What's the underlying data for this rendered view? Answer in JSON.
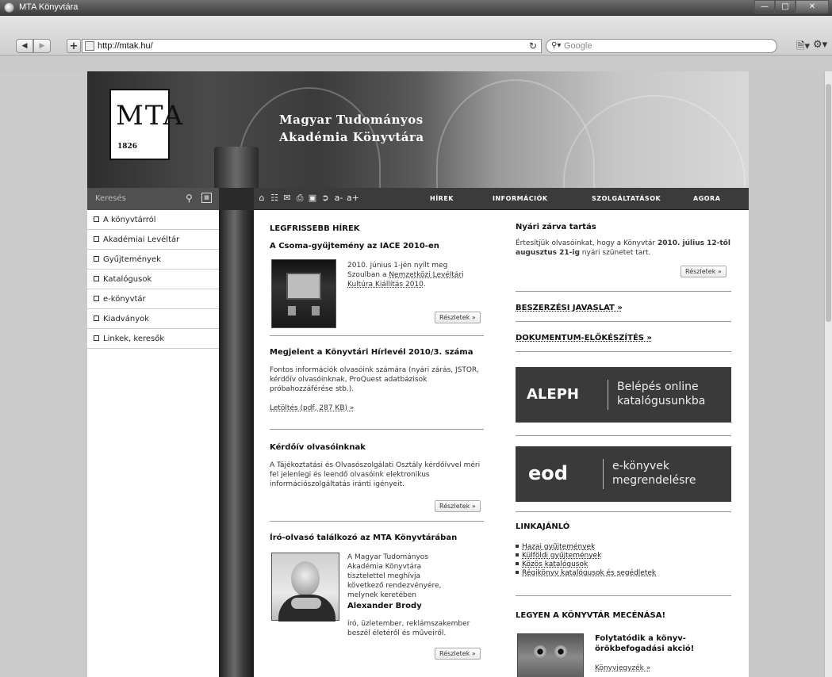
{
  "window": {
    "title": "MTA Könyvtára"
  },
  "browser": {
    "url": "http://mtak.hu/",
    "search_placeholder": "Google"
  },
  "site": {
    "logo_letters": "MTA",
    "logo_year": "1826",
    "title_line1": "Magyar Tudományos",
    "title_line2": "Akadémia Könyvtára"
  },
  "nav": {
    "search_label": "Keresés",
    "font_smaller": "a-",
    "font_larger": "a+",
    "menu": [
      "HÍREK",
      "INFORMÁCIÓK",
      "SZOLGÁLTATÁSOK",
      "AGORA"
    ]
  },
  "sidebar": {
    "items": [
      "A könyvtárról",
      "Akadémiai Levéltár",
      "Gyűjtemények",
      "Katalógusok",
      "e-könyvtár",
      "Kiadványok",
      "Linkek, keresők"
    ]
  },
  "news": {
    "heading": "LEGFRISSEBB HÍREK",
    "more_label": "Részletek »",
    "item1": {
      "title": "A Csoma-gyűjtemény az IACE 2010-en",
      "text_line1": "2010. június 1-jén nyílt meg",
      "text_line2": "Szoulban a ",
      "text_link_a": "Nemzetközi Levéltári",
      "text_link_b": "Kultúra Kiállítás 2010",
      "text_end": "."
    },
    "item2": {
      "title": "Megjelent a Könyvtári Hírlevél 2010/3. száma",
      "text": "Fontos információk olvasóink számára (nyári zárás, JSTOR, kérdőív olvasóinknak, ProQuest adatbázisok próbahozzáférése stb.).",
      "download": "Letöltés (pdf, 287 KB) »"
    },
    "item3": {
      "title": "Kérdőív olvasóinknak",
      "text": "A Tájékoztatási és Olvasószolgálati Osztály kérdőívvel méri fel jelenlegi és leendő olvasóink elektronikus információszolgáltatás iránti igényeit."
    },
    "item4": {
      "title": "Író-olvasó találkozó az MTA Könyvtárában",
      "text": "A Magyar Tudományos Akadémia Könyvtára tisztelettel meghívja következő rendezvényére, melynek keretében",
      "person": "Alexander Brody",
      "person_desc": "író, üzletember, reklámszakember beszél életéről és műveiről."
    }
  },
  "right": {
    "summer": {
      "title": "Nyári zárva tartás",
      "text_a": "Értesítjük olvasóinkat, hogy a Könyvtár ",
      "text_bold": "2010. július 12-től augusztus 21-ig",
      "text_b": " nyári szünetet tart.",
      "more_label": "Részletek »"
    },
    "link1": "BESZERZÉSI JAVASLAT »",
    "link2": "DOKUMENTUM-ELŐKÉSZÍTÉS »",
    "aleph": {
      "logo": "ALEPH",
      "line1": "Belépés online",
      "line2": "katalógusunkba"
    },
    "eod": {
      "logo": "eod",
      "line1": "e-könyvek",
      "line2": "megrendelésre"
    },
    "links_heading": "LINKAJÁNLÓ",
    "links": [
      "Hazai gyűjtemények",
      "Külföldi gyűjtemények",
      "Közös katalógusok",
      "Régikönyv katalógusok és segédletek"
    ],
    "patron_heading": "LEGYEN A KÖNYVTÁR MECÉNÁSA!",
    "patron_title_line1": "Folytatódik a könyv-",
    "patron_title_line2": "örökbefogadási akció!",
    "patron_link": "Könyvjegyzék »"
  }
}
